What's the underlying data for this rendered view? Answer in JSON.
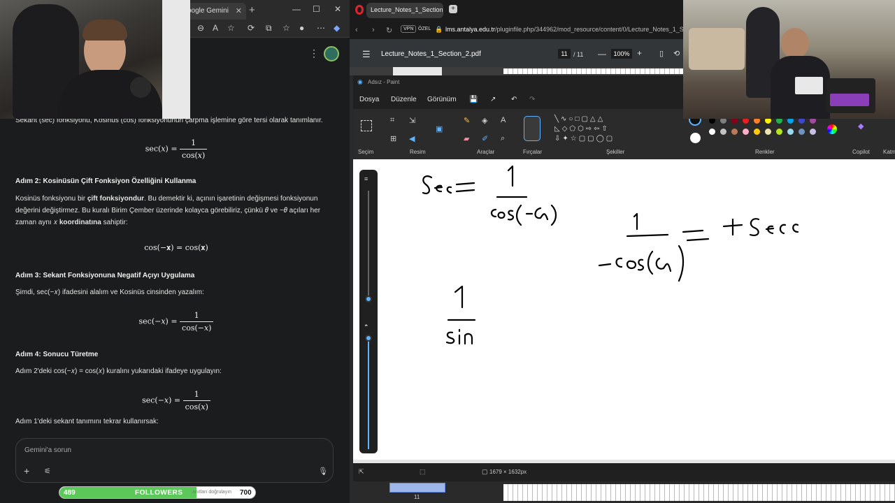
{
  "edge": {
    "tab_title": "oogle Gemini",
    "tab_close": "✕",
    "new_tab": "+",
    "win_min": "—",
    "win_max": "☐",
    "win_close": "✕"
  },
  "gemini": {
    "intro": "Sekant (sec) fonksiyonu, Kosinüs (cos) fonksiyonunun çarpma işlemine göre tersi olarak tanımlanır.",
    "eq1_lhs": "sec(𝑥) =",
    "eq1_num": "1",
    "eq1_den": "cos(𝑥)",
    "step2_title": "Adım 2: Kosinüsün Çift Fonksiyon Özelliğini Kullanma",
    "step2_a": "Kosinüs fonksiyonu bir ",
    "step2_b": "çift fonksiyondur",
    "step2_c": ". Bu demektir ki, açının işaretinin değişmesi fonksiyonun değerini değiştirmez. Bu kuralı Birim Çember üzerinde kolayca görebiliriz, çünkü 𝜃 ve −𝜃 açıları her zaman aynı 𝑥 ",
    "step2_d": "koordinatına",
    "step2_e": " sahiptir:",
    "eq2": "cos(−𝐱) = cos(𝐱)",
    "step3_title": "Adım 3: Sekant Fonksiyonuna Negatif Açıyı Uygulama",
    "step3_text": "Şimdi, sec(−𝑥) ifadesini alalım ve Kosinüs cinsinden yazalım:",
    "eq3_lhs": "sec(−𝑥) =",
    "eq3_num": "1",
    "eq3_den": "cos(−𝑥)",
    "step4_title": "Adım 4: Sonucu Türetme",
    "step4_text": "Adım 2'deki cos(−𝑥) = cos(𝑥) kuralını yukarıdaki ifadeye uygulayın:",
    "eq4_lhs": "sec(−𝑥) =",
    "eq4_num": "1",
    "eq4_den": "cos(𝑥)",
    "step5_text": "Adım 1'deki sekant tanımını tekrar kullanırsak:",
    "input_placeholder": "Gemini'a sorun",
    "plus": "+",
    "tools": "⚟",
    "mic": "🎙"
  },
  "followers": {
    "count": "489",
    "label": "FOLLOWERS",
    "goal": "700",
    "hidden_text": "anıtları doğrulayın",
    "progress": 0.6986
  },
  "opera": {
    "tab_title": "Lecture_Notes_1_Section_",
    "new_tab": "+",
    "vpn": "VPN",
    "private": "ÖZEL",
    "url_domain": "lms.antalya.edu.tr",
    "url_path": "/pluginfile.php/344962/mod_resource/content/0/Lecture_Notes_1_Sect"
  },
  "pdf": {
    "title": "Lecture_Notes_1_Section_2.pdf",
    "page": "11",
    "pages": "/ 11",
    "zoom": "100%",
    "minus": "—",
    "plus": "+",
    "thumb_page": "11"
  },
  "paint": {
    "window_title": "Adsız - Paint",
    "menu": [
      "Dosya",
      "Düzenle",
      "Görünüm"
    ],
    "groups": [
      "Seçim",
      "Resim",
      "Araçlar",
      "Fırçalar",
      "Şekiller",
      "Renkler",
      "Copilot",
      "Katm"
    ],
    "resolution": "1679 × 1632px",
    "palette": [
      "#000000",
      "#7f7f7f",
      "#880015",
      "#ed1c24",
      "#ff7f27",
      "#fff200",
      "#22b14c",
      "#00a2e8",
      "#3f48cc",
      "#a349a4",
      "#ffffff",
      "#c3c3c3",
      "#b97a57",
      "#ffaec9",
      "#ffc90e",
      "#efe4b0",
      "#b5e61d",
      "#99d9ea",
      "#7092be",
      "#c8bfe7"
    ]
  }
}
